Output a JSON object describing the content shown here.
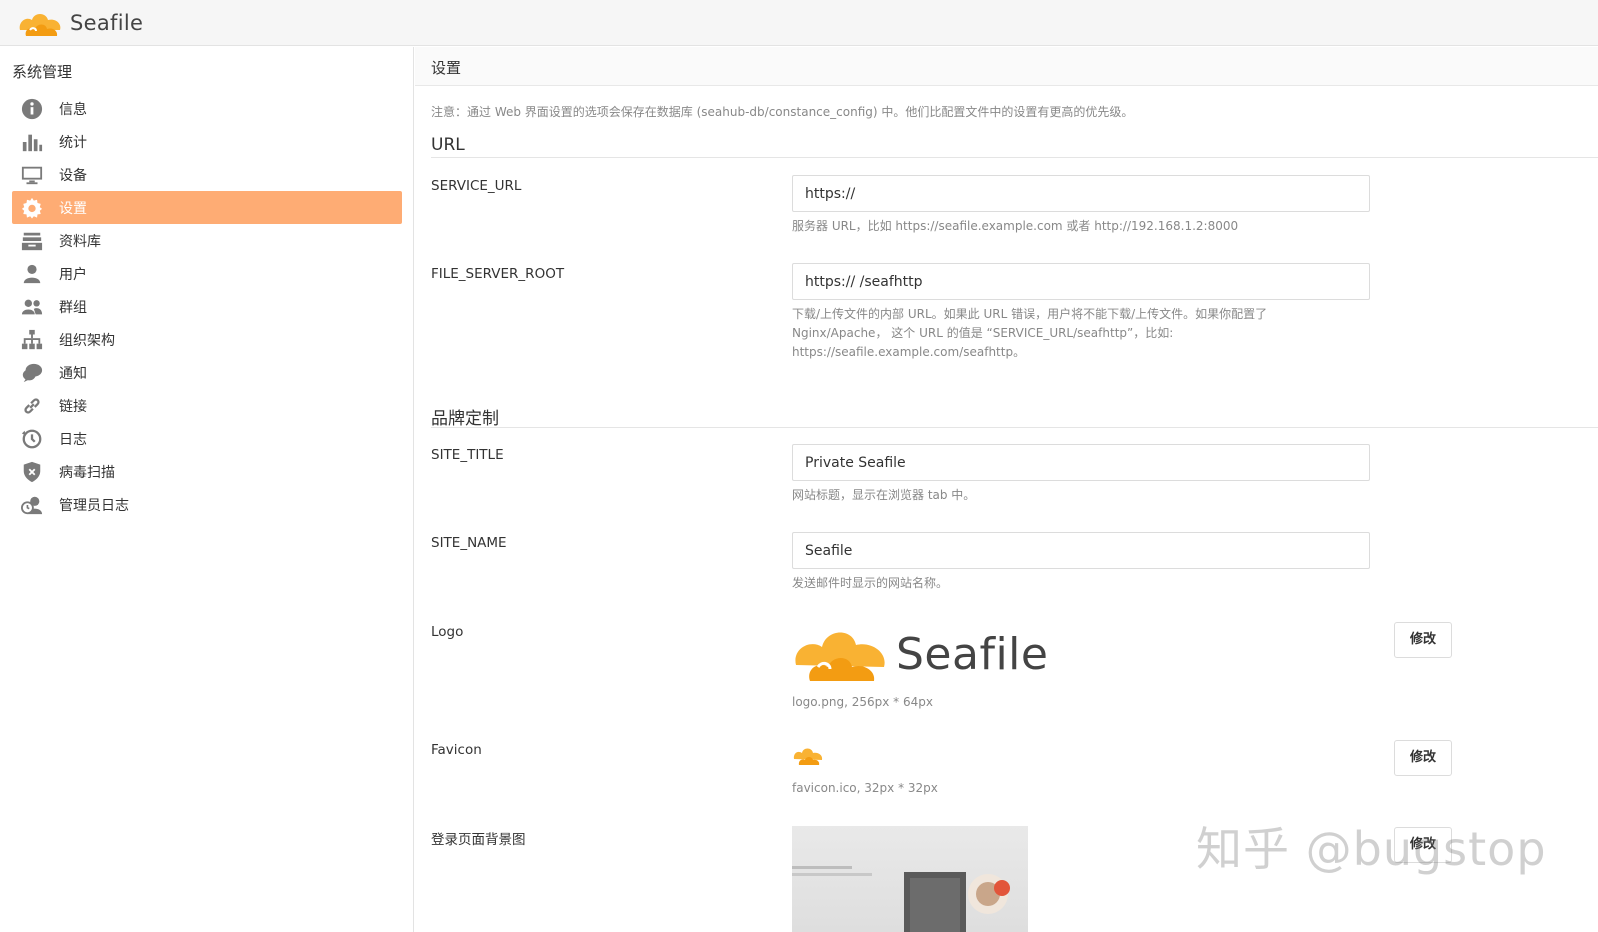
{
  "header": {
    "brand": "Seafile"
  },
  "sidebar": {
    "heading": "系统管理",
    "items": [
      {
        "label": "信息",
        "icon": "info-icon"
      },
      {
        "label": "统计",
        "icon": "bar-chart-icon"
      },
      {
        "label": "设备",
        "icon": "monitor-icon"
      },
      {
        "label": "设置",
        "icon": "gear-icon",
        "active": true
      },
      {
        "label": "资料库",
        "icon": "library-icon"
      },
      {
        "label": "用户",
        "icon": "user-icon"
      },
      {
        "label": "群组",
        "icon": "group-icon"
      },
      {
        "label": "组织架构",
        "icon": "org-chart-icon"
      },
      {
        "label": "通知",
        "icon": "chat-icon"
      },
      {
        "label": "链接",
        "icon": "link-icon"
      },
      {
        "label": "日志",
        "icon": "history-icon"
      },
      {
        "label": "病毒扫描",
        "icon": "shield-icon"
      },
      {
        "label": "管理员日志",
        "icon": "admin-log-icon"
      }
    ],
    "active_color": "#feac74"
  },
  "main": {
    "title": "设置",
    "notice": "注意：通过 Web 界面设置的选项会保存在数据库 (seahub-db/constance_config) 中。他们比配置文件中的设置有更高的优先级。",
    "sections": {
      "url": "URL",
      "branding": "品牌定制"
    },
    "fields": {
      "service_url": {
        "label": "SERVICE_URL",
        "value": "https://",
        "help": "服务器 URL，比如 https://seafile.example.com 或者 http://192.168.1.2:8000"
      },
      "file_server_root": {
        "label": "FILE_SERVER_ROOT",
        "value": "https:// /seafhttp",
        "help_lines": [
          "下载/上传文件的内部 URL。如果此 URL 错误，用户将不能下载/上传文件。如果你配置了",
          "Nginx/Apache， 这个 URL 的值是 “SERVICE_URL/seafhttp”，比如:",
          "https://seafile.example.com/seafhttp。"
        ]
      },
      "site_title": {
        "label": "SITE_TITLE",
        "value": "Private Seafile",
        "help": "网站标题，显示在浏览器 tab 中。"
      },
      "site_name": {
        "label": "SITE_NAME",
        "value": "Seafile",
        "help": "发送邮件时显示的网站名称。"
      },
      "logo": {
        "label": "Logo",
        "logo_text": "Seafile",
        "help": "logo.png, 256px * 64px",
        "button": "修改"
      },
      "favicon": {
        "label": "Favicon",
        "help": "favicon.ico, 32px * 32px",
        "button": "修改"
      },
      "login_bg": {
        "label": "登录页面背景图",
        "button": "修改"
      }
    }
  },
  "watermark": "知乎 @bugstop",
  "colors": {
    "brand_orange": "#f9b233",
    "brand_orange_dark": "#f39c12",
    "accent": "#feac74"
  }
}
